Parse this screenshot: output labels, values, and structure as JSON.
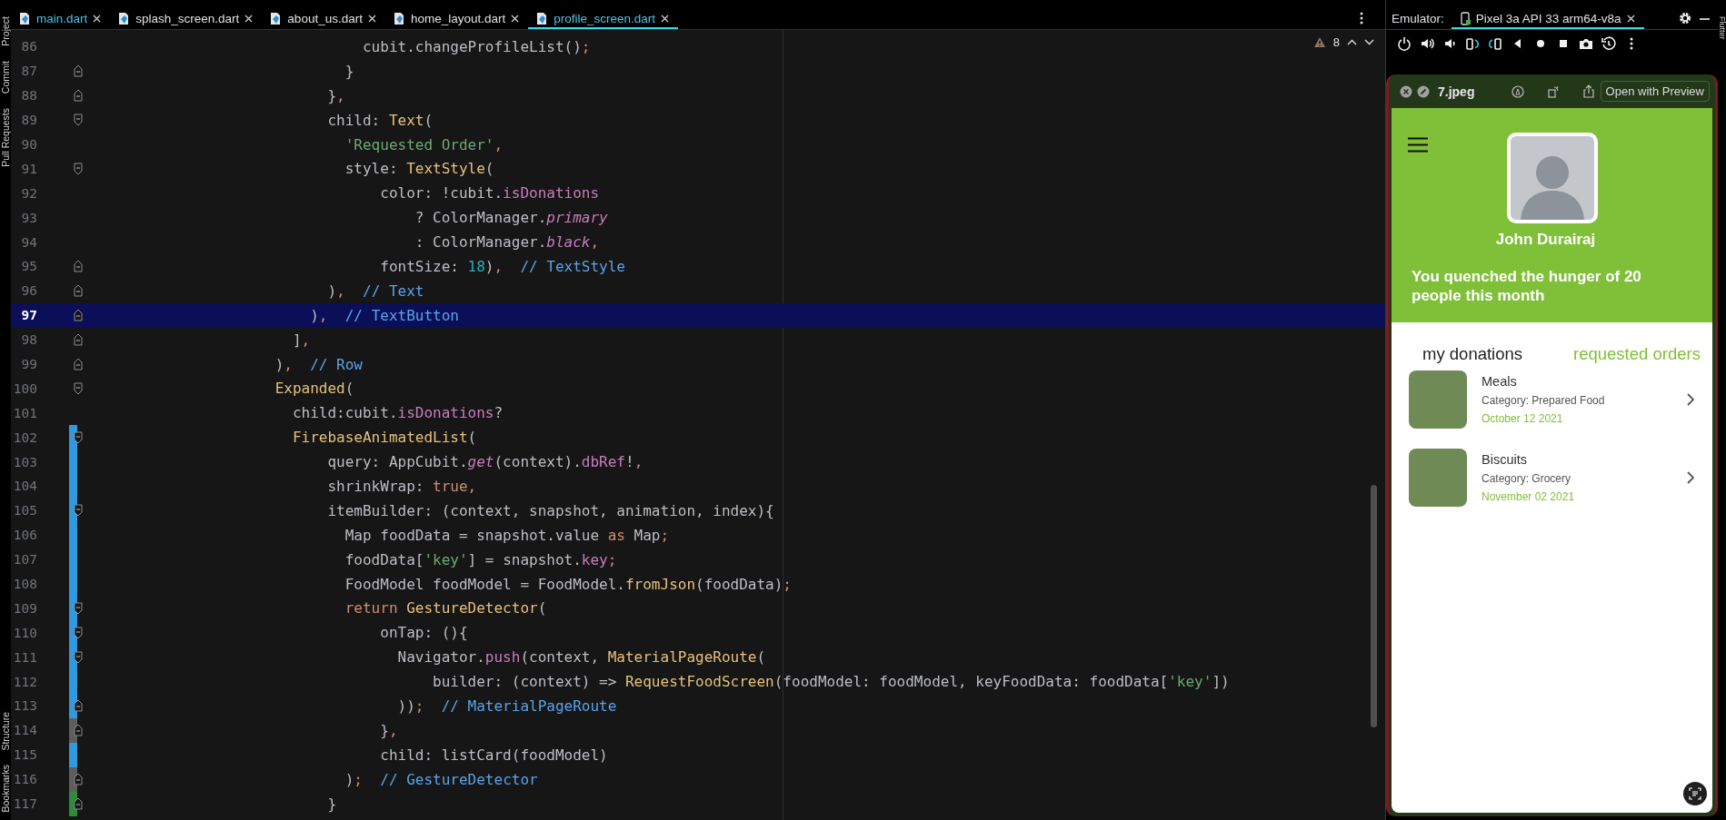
{
  "left_tool_windows": {
    "top": [
      {
        "label": "Project"
      },
      {
        "label": "Commit"
      },
      {
        "label": "Pull Requests"
      }
    ],
    "bottom": [
      {
        "label": "Structure"
      },
      {
        "label": "Bookmarks"
      }
    ]
  },
  "right_tool_windows": {
    "top": [
      {
        "label": "Flutter"
      }
    ]
  },
  "tabs": [
    {
      "label": "main.dart",
      "modified": true,
      "selected": false
    },
    {
      "label": "splash_screen.dart",
      "modified": false,
      "selected": false
    },
    {
      "label": "about_us.dart",
      "modified": false,
      "selected": false
    },
    {
      "label": "home_layout.dart",
      "modified": false,
      "selected": false
    },
    {
      "label": "profile_screen.dart",
      "modified": true,
      "selected": true
    }
  ],
  "editor": {
    "problems": "8",
    "lines": [
      {
        "number": "86",
        "selected": false,
        "kind": "plain",
        "segments": [
          {
            "text": "                              cubit.changeProfileList()",
            "kind": "plain"
          },
          {
            "text": ";",
            "kind": "punc"
          }
        ]
      },
      {
        "number": "87",
        "selected": false,
        "kind": "closer",
        "segments": [
          {
            "text": "                            }",
            "kind": "plain"
          }
        ]
      },
      {
        "number": "88",
        "selected": false,
        "kind": "closer",
        "segments": [
          {
            "text": "                          }",
            "kind": "plain"
          },
          {
            "text": ",",
            "kind": "punc"
          }
        ]
      },
      {
        "number": "89",
        "selected": false,
        "kind": "opener",
        "segments": [
          {
            "text": "                          child: ",
            "kind": "plain"
          },
          {
            "text": "Text",
            "kind": "cls"
          },
          {
            "text": "(",
            "kind": "plain"
          }
        ]
      },
      {
        "number": "90",
        "selected": false,
        "kind": "plain",
        "segments": [
          {
            "text": "                            'Requested Order'",
            "kind": "str"
          },
          {
            "text": ",",
            "kind": "punc"
          }
        ]
      },
      {
        "number": "91",
        "selected": false,
        "kind": "opener",
        "segments": [
          {
            "text": "                            style: ",
            "kind": "plain"
          },
          {
            "text": "TextStyle",
            "kind": "cls"
          },
          {
            "text": "(",
            "kind": "plain"
          }
        ]
      },
      {
        "number": "92",
        "selected": false,
        "kind": "plain",
        "segments": [
          {
            "text": "                                color: !cubit.",
            "kind": "plain"
          },
          {
            "text": "isDonations",
            "kind": "field"
          }
        ]
      },
      {
        "number": "93",
        "selected": false,
        "kind": "plain",
        "segments": [
          {
            "text": "                                    ? ColorManager.",
            "kind": "plain"
          },
          {
            "text": "primary",
            "kind": "static"
          }
        ]
      },
      {
        "number": "94",
        "selected": false,
        "kind": "plain",
        "segments": [
          {
            "text": "                                    : ColorManager.",
            "kind": "plain"
          },
          {
            "text": "black",
            "kind": "static"
          },
          {
            "text": ",",
            "kind": "punc"
          }
        ]
      },
      {
        "number": "95",
        "selected": false,
        "kind": "closer",
        "segments": [
          {
            "text": "                                fontSize: ",
            "kind": "plain"
          },
          {
            "text": "18",
            "kind": "num"
          },
          {
            "text": ")",
            "kind": "plain"
          },
          {
            "text": ",",
            "kind": "punc"
          },
          {
            "text": "  // TextStyle",
            "kind": "label"
          }
        ]
      },
      {
        "number": "96",
        "selected": false,
        "kind": "closer",
        "segments": [
          {
            "text": "                          )",
            "kind": "plain"
          },
          {
            "text": ",",
            "kind": "punc"
          },
          {
            "text": "  // Text",
            "kind": "label"
          }
        ]
      },
      {
        "number": "97",
        "selected": true,
        "kind": "closer",
        "segments": [
          {
            "text": "                        )",
            "kind": "plain"
          },
          {
            "text": ",",
            "kind": "punc"
          },
          {
            "text": "  // TextButton",
            "kind": "label"
          }
        ]
      },
      {
        "number": "98",
        "selected": false,
        "kind": "closer",
        "segments": [
          {
            "text": "                      ]",
            "kind": "plain"
          },
          {
            "text": ",",
            "kind": "punc"
          }
        ]
      },
      {
        "number": "99",
        "selected": false,
        "kind": "closer",
        "segments": [
          {
            "text": "                    )",
            "kind": "plain"
          },
          {
            "text": ",",
            "kind": "punc"
          },
          {
            "text": "  // Row",
            "kind": "label"
          }
        ]
      },
      {
        "number": "100",
        "selected": false,
        "kind": "opener",
        "segments": [
          {
            "text": "                    Expanded",
            "kind": "cls"
          },
          {
            "text": "(",
            "kind": "plain"
          }
        ]
      },
      {
        "number": "101",
        "selected": false,
        "kind": "plain",
        "segments": [
          {
            "text": "                      child:cubit.",
            "kind": "plain"
          },
          {
            "text": "isDonations",
            "kind": "field"
          },
          {
            "text": "?",
            "kind": "plain"
          }
        ]
      },
      {
        "number": "102",
        "selected": false,
        "kind": "opener",
        "color": "#2f9ae0",
        "segments": [
          {
            "text": "                      FirebaseAnimatedList",
            "kind": "cls"
          },
          {
            "text": "(",
            "kind": "plain"
          }
        ]
      },
      {
        "number": "103",
        "selected": false,
        "kind": "plain",
        "color": "#2f9ae0",
        "segments": [
          {
            "text": "                          query: AppCubit.",
            "kind": "plain"
          },
          {
            "text": "get",
            "kind": "static"
          },
          {
            "text": "(context).",
            "kind": "plain"
          },
          {
            "text": "dbRef",
            "kind": "field"
          },
          {
            "text": "!",
            "kind": "plain"
          },
          {
            "text": ",",
            "kind": "punc"
          }
        ]
      },
      {
        "number": "104",
        "selected": false,
        "kind": "plain",
        "color": "#2f9ae0",
        "segments": [
          {
            "text": "                          shrinkWrap: ",
            "kind": "plain"
          },
          {
            "text": "true",
            "kind": "kw"
          },
          {
            "text": ",",
            "kind": "punc"
          }
        ]
      },
      {
        "number": "105",
        "selected": false,
        "kind": "opener",
        "color": "#2f9ae0",
        "segments": [
          {
            "text": "                          itemBuilder: (context, snapshot, animation, index){",
            "kind": "plain"
          }
        ]
      },
      {
        "number": "106",
        "selected": false,
        "kind": "plain",
        "color": "#2f9ae0",
        "segments": [
          {
            "text": "                            Map foodData = snapshot.value ",
            "kind": "plain"
          },
          {
            "text": "as",
            "kind": "kw"
          },
          {
            "text": " Map",
            "kind": "plain"
          },
          {
            "text": ";",
            "kind": "punc"
          }
        ]
      },
      {
        "number": "107",
        "selected": false,
        "kind": "plain",
        "color": "#2f9ae0",
        "segments": [
          {
            "text": "                            foodData[",
            "kind": "plain"
          },
          {
            "text": "'key'",
            "kind": "str"
          },
          {
            "text": "] = snapshot.",
            "kind": "plain"
          },
          {
            "text": "key",
            "kind": "field"
          },
          {
            "text": ";",
            "kind": "punc"
          }
        ]
      },
      {
        "number": "108",
        "selected": false,
        "kind": "plain",
        "color": "#2f9ae0",
        "segments": [
          {
            "text": "                            FoodModel foodModel = FoodModel.",
            "kind": "plain"
          },
          {
            "text": "fromJson",
            "kind": "cls"
          },
          {
            "text": "(foodData)",
            "kind": "plain"
          },
          {
            "text": ";",
            "kind": "punc"
          }
        ]
      },
      {
        "number": "109",
        "selected": false,
        "kind": "opener",
        "color": "#2f9ae0",
        "segments": [
          {
            "text": "                            return",
            "kind": "kw"
          },
          {
            "text": " GestureDetector",
            "kind": "cls"
          },
          {
            "text": "(",
            "kind": "plain"
          }
        ]
      },
      {
        "number": "110",
        "selected": false,
        "kind": "opener",
        "color": "#2f9ae0",
        "segments": [
          {
            "text": "                                onTap: (){",
            "kind": "plain"
          }
        ]
      },
      {
        "number": "111",
        "selected": false,
        "kind": "opener",
        "color": "#2f9ae0",
        "segments": [
          {
            "text": "                                  Navigator.",
            "kind": "plain"
          },
          {
            "text": "push",
            "kind": "field"
          },
          {
            "text": "(context, ",
            "kind": "plain"
          },
          {
            "text": "MaterialPageRoute",
            "kind": "cls"
          },
          {
            "text": "(",
            "kind": "plain"
          }
        ]
      },
      {
        "number": "112",
        "selected": false,
        "kind": "plain",
        "color": "#2f9ae0",
        "segments": [
          {
            "text": "                                      builder: (context) => ",
            "kind": "plain"
          },
          {
            "text": "RequestFoodScreen",
            "kind": "cls"
          },
          {
            "text": "(foodModel: foodModel, keyFoodData: foodData[",
            "kind": "plain"
          },
          {
            "text": "'key'",
            "kind": "str"
          },
          {
            "text": "])",
            "kind": "plain"
          }
        ]
      },
      {
        "number": "113",
        "selected": false,
        "kind": "closer",
        "color": "#2f9ae0",
        "segments": [
          {
            "text": "                                  ))",
            "kind": "plain"
          },
          {
            "text": ";",
            "kind": "punc"
          },
          {
            "text": "  // MaterialPageRoute",
            "kind": "label"
          }
        ]
      },
      {
        "number": "114",
        "selected": false,
        "kind": "closer",
        "color": "#5e5e5e",
        "segments": [
          {
            "text": "                                }",
            "kind": "plain"
          },
          {
            "text": ",",
            "kind": "punc"
          }
        ]
      },
      {
        "number": "115",
        "selected": false,
        "kind": "plain",
        "color": "#2f9ae0",
        "segments": [
          {
            "text": "                                child: listCard(foodModel)",
            "kind": "plain"
          }
        ]
      },
      {
        "number": "116",
        "selected": false,
        "kind": "closer",
        "color": "#5e5e5e",
        "segments": [
          {
            "text": "                            )",
            "kind": "plain"
          },
          {
            "text": ";",
            "kind": "punc"
          },
          {
            "text": "  // GestureDetector",
            "kind": "label"
          }
        ]
      },
      {
        "number": "117",
        "selected": false,
        "kind": "closer",
        "color": "#2f8a3a",
        "segments": [
          {
            "text": "                          }",
            "kind": "plain"
          }
        ]
      }
    ]
  },
  "emulator": {
    "label": "Emulator:",
    "devices": [
      {
        "label": "Pixel 3a API 33 arm64-v8a",
        "selected": true
      }
    ]
  },
  "preview": {
    "title": "7.jpeg",
    "action": "Open with Preview"
  },
  "app": {
    "name": "John Durairaj",
    "message": "You quenched the hunger of 20 people this month",
    "tabs": [
      {
        "label": "my donations",
        "selected": false
      },
      {
        "label": "requested orders",
        "selected": true
      }
    ],
    "items": [
      {
        "title": "Meals",
        "category": "Category: Prepared Food",
        "date": "October 12 2021"
      },
      {
        "title": "Biscuits",
        "category": "Category: Grocery",
        "date": "November 02 2021"
      }
    ]
  }
}
